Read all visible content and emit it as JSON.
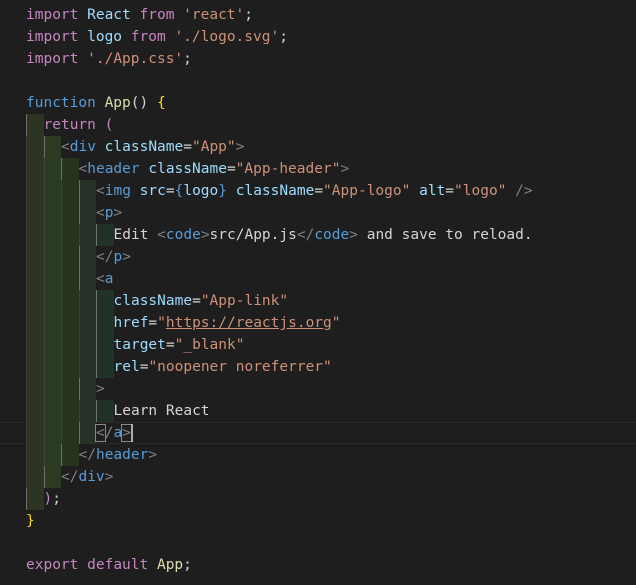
{
  "editor": {
    "language": "javascript-react",
    "theme_colors": {
      "background": "#1e1e1e",
      "keyword": "#c586c0",
      "string": "#ce9178",
      "function": "#dcdcaa",
      "tag": "#569cd6",
      "attribute": "#9cdcfe",
      "text": "#d4d4d4",
      "punctuation": "#808080",
      "bracket": "#ffd700",
      "indent_rainbow": [
        "#2c3523",
        "#2b3a22",
        "#28331f",
        "#263128",
        "#213227"
      ]
    },
    "lines": [
      {
        "indent": 0,
        "tokens": [
          {
            "t": "import",
            "c": "kw"
          },
          {
            "t": " React ",
            "c": "va"
          },
          {
            "t": "from",
            "c": "kw"
          },
          {
            "t": " ",
            "c": "tx"
          },
          {
            "t": "'react'",
            "c": "st"
          },
          {
            "t": ";",
            "c": "tx"
          }
        ]
      },
      {
        "indent": 0,
        "tokens": [
          {
            "t": "import",
            "c": "kw"
          },
          {
            "t": " logo ",
            "c": "va"
          },
          {
            "t": "from",
            "c": "kw"
          },
          {
            "t": " ",
            "c": "tx"
          },
          {
            "t": "'./logo.svg'",
            "c": "st"
          },
          {
            "t": ";",
            "c": "tx"
          }
        ]
      },
      {
        "indent": 0,
        "tokens": [
          {
            "t": "import",
            "c": "kw"
          },
          {
            "t": " ",
            "c": "tx"
          },
          {
            "t": "'./App.css'",
            "c": "st"
          },
          {
            "t": ";",
            "c": "tx"
          }
        ]
      },
      {
        "indent": 0,
        "tokens": []
      },
      {
        "indent": 0,
        "tokens": [
          {
            "t": "function",
            "c": "kb"
          },
          {
            "t": " ",
            "c": "tx"
          },
          {
            "t": "App",
            "c": "fn"
          },
          {
            "t": "() ",
            "c": "tx"
          },
          {
            "t": "{",
            "c": "br"
          }
        ]
      },
      {
        "indent": 1,
        "tokens": [
          {
            "t": "return",
            "c": "kw"
          },
          {
            "t": " ",
            "c": "tx"
          },
          {
            "t": "(",
            "c": "kw"
          }
        ]
      },
      {
        "indent": 2,
        "tokens": [
          {
            "t": "<",
            "c": "pu"
          },
          {
            "t": "div",
            "c": "tg"
          },
          {
            "t": " ",
            "c": "tx"
          },
          {
            "t": "className",
            "c": "at"
          },
          {
            "t": "=",
            "c": "tx"
          },
          {
            "t": "\"App\"",
            "c": "st"
          },
          {
            "t": ">",
            "c": "pu"
          }
        ]
      },
      {
        "indent": 3,
        "tokens": [
          {
            "t": "<",
            "c": "pu"
          },
          {
            "t": "header",
            "c": "tg"
          },
          {
            "t": " ",
            "c": "tx"
          },
          {
            "t": "className",
            "c": "at"
          },
          {
            "t": "=",
            "c": "tx"
          },
          {
            "t": "\"App-header\"",
            "c": "st"
          },
          {
            "t": ">",
            "c": "pu"
          }
        ]
      },
      {
        "indent": 4,
        "tokens": [
          {
            "t": "<",
            "c": "pu"
          },
          {
            "t": "img",
            "c": "tg"
          },
          {
            "t": " ",
            "c": "tx"
          },
          {
            "t": "src",
            "c": "at"
          },
          {
            "t": "=",
            "c": "tx"
          },
          {
            "t": "{",
            "c": "tg"
          },
          {
            "t": "logo",
            "c": "va"
          },
          {
            "t": "}",
            "c": "tg"
          },
          {
            "t": " ",
            "c": "tx"
          },
          {
            "t": "className",
            "c": "at"
          },
          {
            "t": "=",
            "c": "tx"
          },
          {
            "t": "\"App-logo\"",
            "c": "st"
          },
          {
            "t": " ",
            "c": "tx"
          },
          {
            "t": "alt",
            "c": "at"
          },
          {
            "t": "=",
            "c": "tx"
          },
          {
            "t": "\"logo\"",
            "c": "st"
          },
          {
            "t": " />",
            "c": "pu"
          }
        ]
      },
      {
        "indent": 4,
        "tokens": [
          {
            "t": "<",
            "c": "pu"
          },
          {
            "t": "p",
            "c": "tg"
          },
          {
            "t": ">",
            "c": "pu"
          }
        ]
      },
      {
        "indent": 5,
        "tokens": [
          {
            "t": "Edit ",
            "c": "tx"
          },
          {
            "t": "<",
            "c": "pu"
          },
          {
            "t": "code",
            "c": "tg"
          },
          {
            "t": ">",
            "c": "pu"
          },
          {
            "t": "src/App.js",
            "c": "tx"
          },
          {
            "t": "</",
            "c": "pu"
          },
          {
            "t": "code",
            "c": "tg"
          },
          {
            "t": ">",
            "c": "pu"
          },
          {
            "t": " and save to reload.",
            "c": "tx"
          }
        ]
      },
      {
        "indent": 4,
        "tokens": [
          {
            "t": "</",
            "c": "pu"
          },
          {
            "t": "p",
            "c": "tg"
          },
          {
            "t": ">",
            "c": "pu"
          }
        ]
      },
      {
        "indent": 4,
        "tokens": [
          {
            "t": "<",
            "c": "pu"
          },
          {
            "t": "a",
            "c": "tg"
          }
        ]
      },
      {
        "indent": 5,
        "tokens": [
          {
            "t": "className",
            "c": "at"
          },
          {
            "t": "=",
            "c": "tx"
          },
          {
            "t": "\"App-link\"",
            "c": "st"
          }
        ]
      },
      {
        "indent": 5,
        "tokens": [
          {
            "t": "href",
            "c": "at"
          },
          {
            "t": "=",
            "c": "tx"
          },
          {
            "t": "\"",
            "c": "st"
          },
          {
            "t": "https://reactjs.org",
            "c": "st",
            "u": 1
          },
          {
            "t": "\"",
            "c": "st"
          }
        ]
      },
      {
        "indent": 5,
        "tokens": [
          {
            "t": "target",
            "c": "at"
          },
          {
            "t": "=",
            "c": "tx"
          },
          {
            "t": "\"_blank\"",
            "c": "st"
          }
        ]
      },
      {
        "indent": 5,
        "tokens": [
          {
            "t": "rel",
            "c": "at"
          },
          {
            "t": "=",
            "c": "tx"
          },
          {
            "t": "\"noopener noreferrer\"",
            "c": "st"
          }
        ]
      },
      {
        "indent": 4,
        "tokens": [
          {
            "t": ">",
            "c": "pu"
          }
        ]
      },
      {
        "indent": 5,
        "tokens": [
          {
            "t": "Learn React",
            "c": "tx"
          }
        ]
      },
      {
        "indent": 4,
        "current": true,
        "tokens": [
          {
            "t": "<",
            "c": "pu",
            "bm": 1
          },
          {
            "t": "/",
            "c": "pu"
          },
          {
            "t": "a",
            "c": "tg"
          },
          {
            "t": ">",
            "c": "pu",
            "bm": 1
          }
        ]
      },
      {
        "indent": 3,
        "tokens": [
          {
            "t": "</",
            "c": "pu"
          },
          {
            "t": "header",
            "c": "tg"
          },
          {
            "t": ">",
            "c": "pu"
          }
        ]
      },
      {
        "indent": 2,
        "tokens": [
          {
            "t": "</",
            "c": "pu"
          },
          {
            "t": "div",
            "c": "tg"
          },
          {
            "t": ">",
            "c": "pu"
          }
        ]
      },
      {
        "indent": 1,
        "tokens": [
          {
            "t": ")",
            "c": "kw"
          },
          {
            "t": ";",
            "c": "tx"
          }
        ]
      },
      {
        "indent": 0,
        "tokens": [
          {
            "t": "}",
            "c": "br"
          }
        ]
      },
      {
        "indent": 0,
        "tokens": []
      },
      {
        "indent": 0,
        "tokens": [
          {
            "t": "export",
            "c": "kw"
          },
          {
            "t": " ",
            "c": "tx"
          },
          {
            "t": "default",
            "c": "kw"
          },
          {
            "t": " ",
            "c": "tx"
          },
          {
            "t": "App",
            "c": "fn"
          },
          {
            "t": ";",
            "c": "tx"
          }
        ]
      }
    ]
  }
}
